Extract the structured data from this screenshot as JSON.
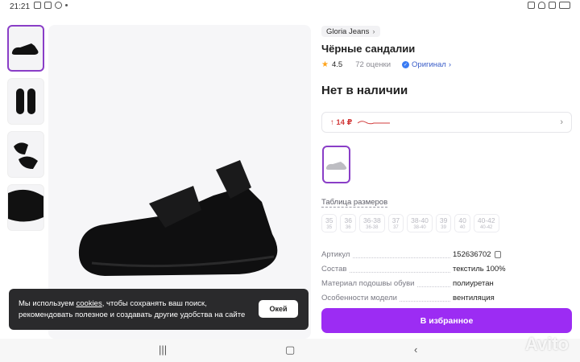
{
  "status": {
    "time": "21:21"
  },
  "product": {
    "brand": "Gloria Jeans",
    "title": "Чёрные сандалии",
    "rating": "4.5",
    "reviews": "72 оценки",
    "original": "Оригинал",
    "stock": "Нет в наличии",
    "price_change": "↑ 14 ₽"
  },
  "size_table_label": "Таблица размеров",
  "sizes": [
    {
      "main": "35",
      "sub": "35"
    },
    {
      "main": "36",
      "sub": "36"
    },
    {
      "main": "36-38",
      "sub": "36-38"
    },
    {
      "main": "37",
      "sub": "37"
    },
    {
      "main": "38-40",
      "sub": "38-40"
    },
    {
      "main": "39",
      "sub": "39"
    },
    {
      "main": "40",
      "sub": "40"
    },
    {
      "main": "40-42",
      "sub": "40-42"
    }
  ],
  "specs": [
    {
      "key": "Артикул",
      "value": "152636702"
    },
    {
      "key": "Состав",
      "value": "текстиль 100%"
    },
    {
      "key": "Материал подошвы обуви",
      "value": "полиуретан"
    },
    {
      "key": "Особенности модели",
      "value": "вентиляция"
    }
  ],
  "favorite_button": "В избранное",
  "cookie": {
    "text_before": "Мы используем ",
    "link": "cookies",
    "text_after": ", чтобы сохранять ваш поиск, рекомендовать полезное и создавать другие удобства на сайте",
    "ok": "Окей"
  },
  "watermark": "Avito",
  "colors": {
    "accent": "#9c2cf3",
    "price_up": "#d23c3c",
    "original": "#3a5dc8"
  }
}
